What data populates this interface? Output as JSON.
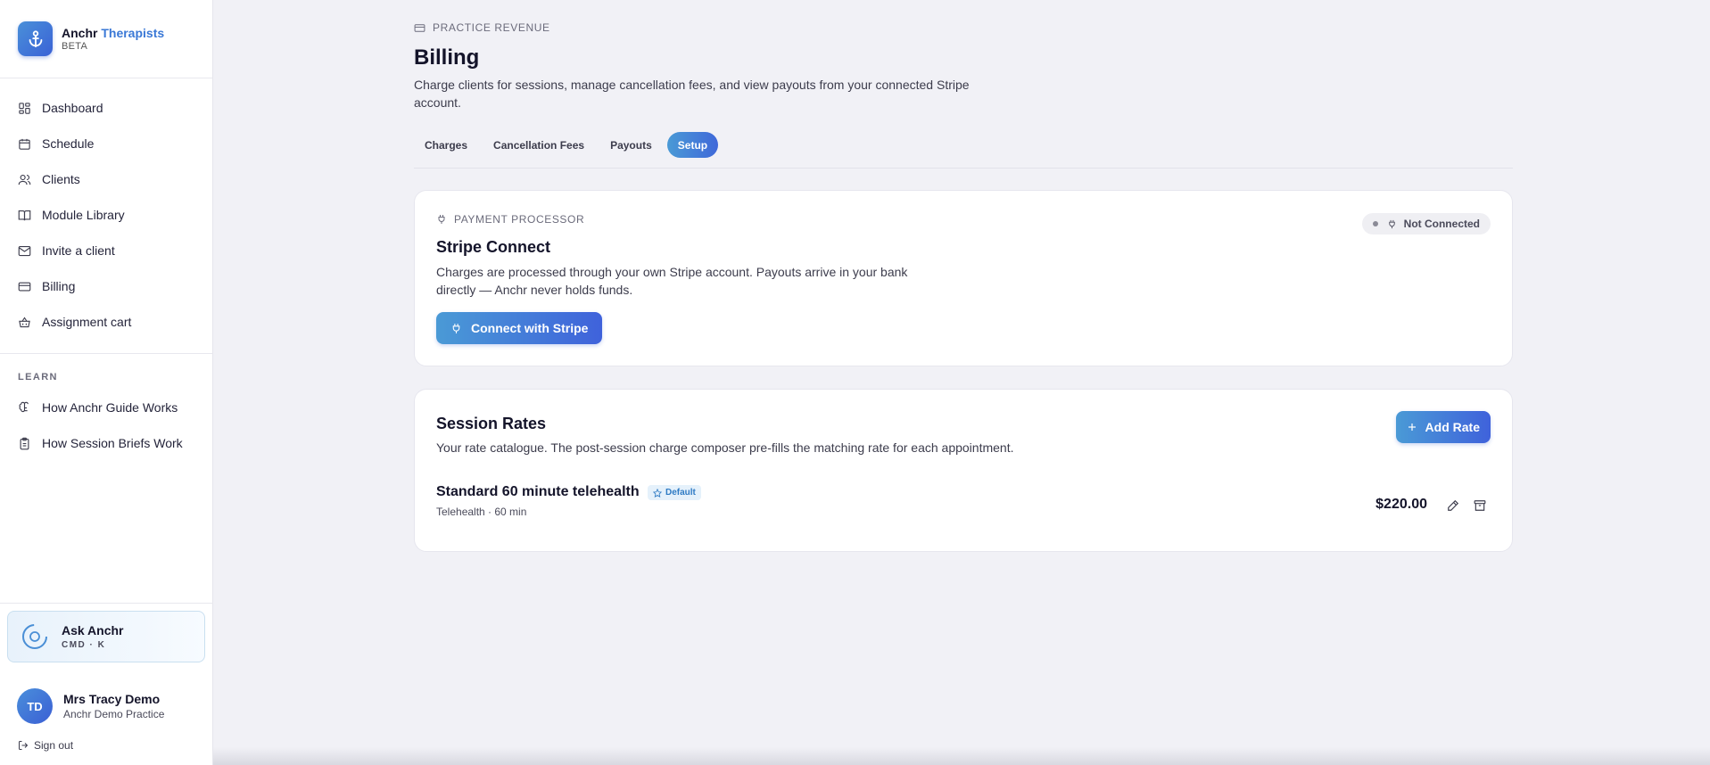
{
  "brand": {
    "name": "Anchr",
    "name_accent": "Therapists",
    "tag": "BETA"
  },
  "nav": {
    "items": [
      {
        "label": "Dashboard",
        "icon": "dashboard-icon"
      },
      {
        "label": "Schedule",
        "icon": "calendar-icon"
      },
      {
        "label": "Clients",
        "icon": "users-icon"
      },
      {
        "label": "Module Library",
        "icon": "book-icon"
      },
      {
        "label": "Invite a client",
        "icon": "mail-icon"
      },
      {
        "label": "Billing",
        "icon": "credit-card-icon"
      },
      {
        "label": "Assignment cart",
        "icon": "basket-icon"
      }
    ],
    "learn_title": "LEARN",
    "learn_items": [
      {
        "label": "How Anchr Guide Works",
        "icon": "brain-icon"
      },
      {
        "label": "How Session Briefs Work",
        "icon": "clipboard-icon"
      }
    ]
  },
  "ask": {
    "title": "Ask Anchr",
    "shortcut": "CMD · K"
  },
  "user": {
    "initials": "TD",
    "name": "Mrs Tracy Demo",
    "practice": "Anchr Demo Practice",
    "signout": "Sign out"
  },
  "page": {
    "eyebrow": "PRACTICE REVENUE",
    "title": "Billing",
    "description": "Charge clients for sessions, manage cancellation fees, and view payouts from your connected Stripe account."
  },
  "tabs": [
    {
      "label": "Charges",
      "active": false
    },
    {
      "label": "Cancellation Fees",
      "active": false
    },
    {
      "label": "Payouts",
      "active": false
    },
    {
      "label": "Setup",
      "active": true
    }
  ],
  "stripe": {
    "eyebrow": "PAYMENT PROCESSOR",
    "title": "Stripe Connect",
    "description": "Charges are processed through your own Stripe account. Payouts arrive in your bank directly — Anchr never holds funds.",
    "status": "Not Connected",
    "button": "Connect with Stripe"
  },
  "rates": {
    "title": "Session Rates",
    "description": "Your rate catalogue. The post-session charge composer pre-fills the matching rate for each appointment.",
    "add_button": "Add Rate",
    "items": [
      {
        "name": "Standard 60 minute telehealth",
        "badge": "Default",
        "meta": "Telehealth · 60 min",
        "price": "$220.00"
      }
    ]
  },
  "colors": {
    "accent": "#3f68d9",
    "accent_light": "#4a9ad6",
    "brand_accent": "#3a78d6"
  }
}
